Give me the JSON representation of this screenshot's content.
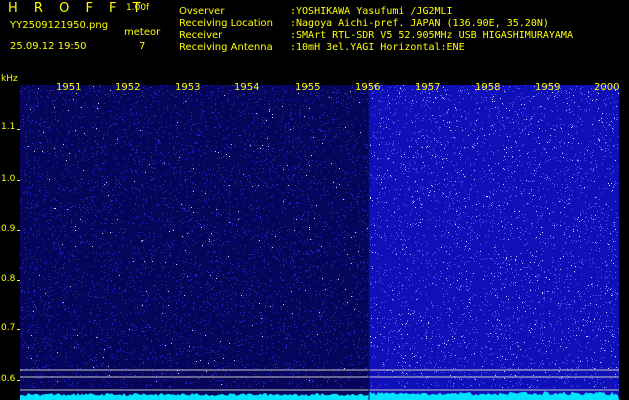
{
  "app": {
    "brand": "H R O F F T",
    "version": "1.00f"
  },
  "file": {
    "name": "YY2509121950.png",
    "datetime": "25.09.12 19:50"
  },
  "meteor": {
    "label": "meteor",
    "count": "7"
  },
  "meta": [
    {
      "key": "Ovserver",
      "value": ":YOSHIKAWA Yasufumi /JG2MLI"
    },
    {
      "key": "Receiving Location",
      "value": ":Nagoya Aichi-pref. JAPAN (136.90E, 35.20N)"
    },
    {
      "key": "Receiver",
      "value": ":SMArt RTL-SDR V5 52.905MHz USB HIGASHIMURAYAMA"
    },
    {
      "key": "Receiving Antenna",
      "value": ":10mH 3el.YAGI Horizontal:ENE"
    }
  ],
  "axis": {
    "y_unit": "kHz",
    "y_ticks": [
      "1.1",
      "1.0",
      "0.9",
      "0.8",
      "0.7",
      "0.6"
    ],
    "x_ticks": [
      "1951",
      "1952",
      "1953",
      "1954",
      "1955",
      "1956",
      "1957",
      "1958",
      "1959",
      "2000"
    ]
  },
  "colors": {
    "text": "#ffff00",
    "background": "#000000",
    "noise_dark": "#1a1ab0",
    "noise_bright": "#3a3aff",
    "baseline": "#00e5ff"
  }
}
